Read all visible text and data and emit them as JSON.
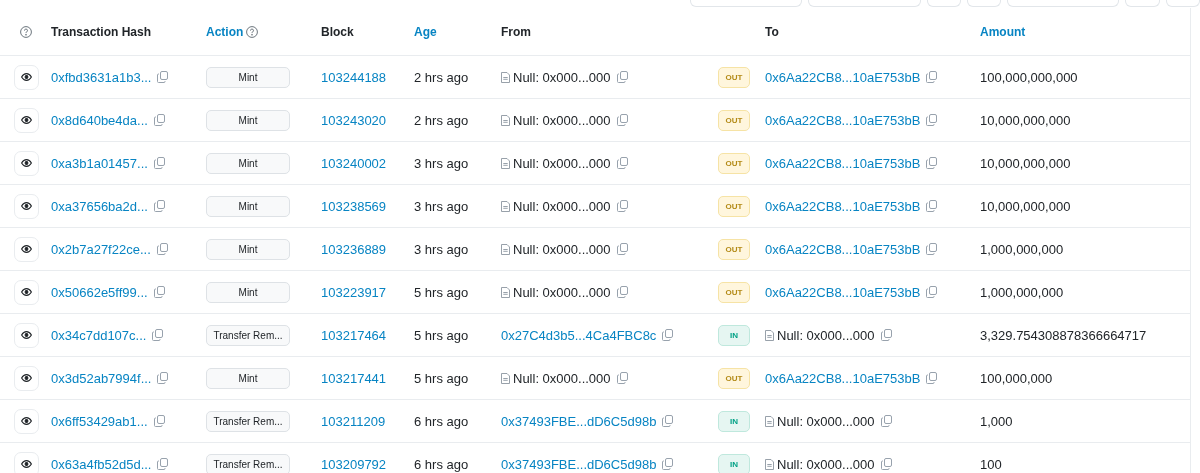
{
  "toolbar": {
    "buttons": [
      {
        "kind": "wide"
      },
      {
        "kind": "wide"
      },
      {
        "kind": "small"
      },
      {
        "kind": "small"
      },
      {
        "kind": "wide"
      },
      {
        "kind": "small"
      },
      {
        "kind": "small"
      }
    ]
  },
  "table": {
    "columns": [
      {
        "label": "Transaction Hash",
        "link": false,
        "help": false
      },
      {
        "label": "Action",
        "link": true,
        "help": true
      },
      {
        "label": "Block",
        "link": false,
        "help": false
      },
      {
        "label": "Age",
        "link": true,
        "help": false
      },
      {
        "label": "From",
        "link": false,
        "help": false
      },
      {
        "label": "To",
        "link": false,
        "help": false
      },
      {
        "label": "Amount",
        "link": true,
        "help": false
      }
    ],
    "rows": [
      {
        "hash": "0xfbd3631a1b3...",
        "action": "Mint",
        "block": "103244188",
        "age": "2 hrs ago",
        "from": {
          "kind": "null",
          "text": "Null: 0x000...000"
        },
        "direction": {
          "kind": "out",
          "label": "OUT"
        },
        "to": {
          "kind": "address",
          "text": "0x6Aa22CB8...10aE753bB"
        },
        "amount": "100,000,000,000"
      },
      {
        "hash": "0x8d640be4da...",
        "action": "Mint",
        "block": "103243020",
        "age": "2 hrs ago",
        "from": {
          "kind": "null",
          "text": "Null: 0x000...000"
        },
        "direction": {
          "kind": "out",
          "label": "OUT"
        },
        "to": {
          "kind": "address",
          "text": "0x6Aa22CB8...10aE753bB"
        },
        "amount": "10,000,000,000"
      },
      {
        "hash": "0xa3b1a01457...",
        "action": "Mint",
        "block": "103240002",
        "age": "3 hrs ago",
        "from": {
          "kind": "null",
          "text": "Null: 0x000...000"
        },
        "direction": {
          "kind": "out",
          "label": "OUT"
        },
        "to": {
          "kind": "address",
          "text": "0x6Aa22CB8...10aE753bB"
        },
        "amount": "10,000,000,000"
      },
      {
        "hash": "0xa37656ba2d...",
        "action": "Mint",
        "block": "103238569",
        "age": "3 hrs ago",
        "from": {
          "kind": "null",
          "text": "Null: 0x000...000"
        },
        "direction": {
          "kind": "out",
          "label": "OUT"
        },
        "to": {
          "kind": "address",
          "text": "0x6Aa22CB8...10aE753bB"
        },
        "amount": "10,000,000,000"
      },
      {
        "hash": "0x2b7a27f22ce...",
        "action": "Mint",
        "block": "103236889",
        "age": "3 hrs ago",
        "from": {
          "kind": "null",
          "text": "Null: 0x000...000"
        },
        "direction": {
          "kind": "out",
          "label": "OUT"
        },
        "to": {
          "kind": "address",
          "text": "0x6Aa22CB8...10aE753bB"
        },
        "amount": "1,000,000,000"
      },
      {
        "hash": "0x50662e5ff99...",
        "action": "Mint",
        "block": "103223917",
        "age": "5 hrs ago",
        "from": {
          "kind": "null",
          "text": "Null: 0x000...000"
        },
        "direction": {
          "kind": "out",
          "label": "OUT"
        },
        "to": {
          "kind": "address",
          "text": "0x6Aa22CB8...10aE753bB"
        },
        "amount": "1,000,000,000"
      },
      {
        "hash": "0x34c7dd107c...",
        "action": "Transfer Rem...",
        "block": "103217464",
        "age": "5 hrs ago",
        "from": {
          "kind": "address",
          "text": "0x27C4d3b5...4Ca4FBC8c"
        },
        "direction": {
          "kind": "in",
          "label": "IN"
        },
        "to": {
          "kind": "null",
          "text": "Null: 0x000...000"
        },
        "amount": "3,329.754308878366664717"
      },
      {
        "hash": "0x3d52ab7994f...",
        "action": "Mint",
        "block": "103217441",
        "age": "5 hrs ago",
        "from": {
          "kind": "null",
          "text": "Null: 0x000...000"
        },
        "direction": {
          "kind": "out",
          "label": "OUT"
        },
        "to": {
          "kind": "address",
          "text": "0x6Aa22CB8...10aE753bB"
        },
        "amount": "100,000,000"
      },
      {
        "hash": "0x6ff53429ab1...",
        "action": "Transfer Rem...",
        "block": "103211209",
        "age": "6 hrs ago",
        "from": {
          "kind": "address",
          "text": "0x37493FBE...dD6C5d98b"
        },
        "direction": {
          "kind": "in",
          "label": "IN"
        },
        "to": {
          "kind": "null",
          "text": "Null: 0x000...000"
        },
        "amount": "1,000"
      },
      {
        "hash": "0x63a4fb52d5d...",
        "action": "Transfer Rem...",
        "block": "103209792",
        "age": "6 hrs ago",
        "from": {
          "kind": "address",
          "text": "0x37493FBE...dD6C5d98b"
        },
        "direction": {
          "kind": "in",
          "label": "IN"
        },
        "to": {
          "kind": "null",
          "text": "Null: 0x000...000"
        },
        "amount": "100"
      }
    ]
  }
}
